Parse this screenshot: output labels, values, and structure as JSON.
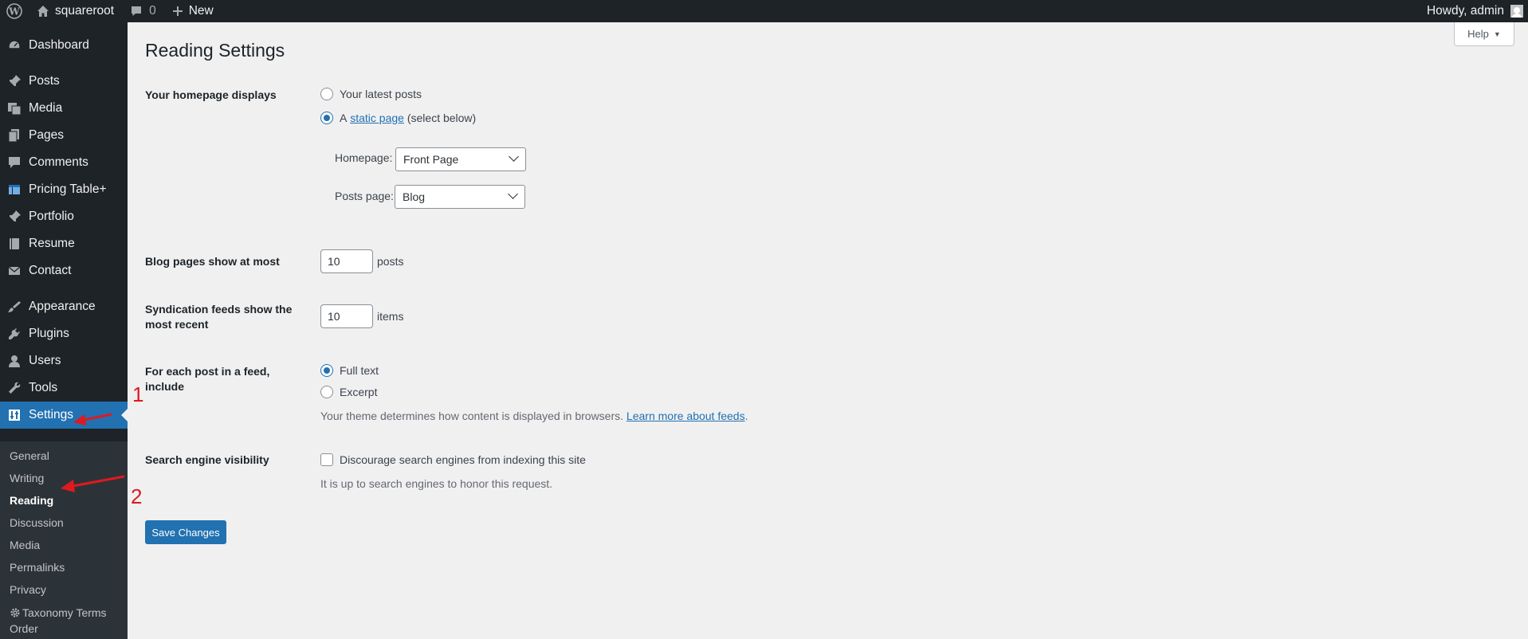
{
  "adminbar": {
    "site_name": "squareroot",
    "comments_count": "0",
    "new_label": "New",
    "greeting": "Howdy, admin"
  },
  "sidebar": {
    "items": [
      {
        "label": "Dashboard",
        "icon": "dashboard-icon"
      },
      {
        "label": "Posts",
        "icon": "pin-icon"
      },
      {
        "label": "Media",
        "icon": "media-icon"
      },
      {
        "label": "Pages",
        "icon": "pages-icon"
      },
      {
        "label": "Comments",
        "icon": "comment-icon"
      },
      {
        "label": "Pricing Table+",
        "icon": "table-icon"
      },
      {
        "label": "Portfolio",
        "icon": "pin-icon"
      },
      {
        "label": "Resume",
        "icon": "book-icon"
      },
      {
        "label": "Contact",
        "icon": "mail-icon"
      },
      {
        "label": "Appearance",
        "icon": "brush-icon"
      },
      {
        "label": "Plugins",
        "icon": "plug-icon"
      },
      {
        "label": "Users",
        "icon": "user-icon"
      },
      {
        "label": "Tools",
        "icon": "wrench-icon"
      },
      {
        "label": "Settings",
        "icon": "settings-icon"
      }
    ],
    "submenu": [
      {
        "label": "General"
      },
      {
        "label": "Writing"
      },
      {
        "label": "Reading"
      },
      {
        "label": "Discussion"
      },
      {
        "label": "Media"
      },
      {
        "label": "Permalinks"
      },
      {
        "label": "Privacy"
      },
      {
        "label": "Taxonomy Terms",
        "label2": "Order"
      }
    ]
  },
  "annotations": {
    "step1": "1",
    "step2": "2",
    "arrow_color": "#e0191f"
  },
  "main": {
    "help_label": "Help",
    "title": "Reading Settings",
    "homepage_displays": {
      "label": "Your homepage displays",
      "option_latest": "Your latest posts",
      "option_static_prefix": "A",
      "option_static_link": "static page",
      "option_static_suffix": "(select below)",
      "homepage_label": "Homepage:",
      "homepage_value": "Front Page",
      "posts_page_label": "Posts page:",
      "posts_page_value": "Blog",
      "selected": "static"
    },
    "blog_pages": {
      "label": "Blog pages show at most",
      "value": "10",
      "unit": "posts"
    },
    "syndication": {
      "label_line1": "Syndication feeds show the",
      "label_line2": "most recent",
      "value": "10",
      "unit": "items"
    },
    "feed_include": {
      "label": "For each post in a feed, include",
      "option_full": "Full text",
      "option_excerpt": "Excerpt",
      "selected": "full",
      "desc_prefix": "Your theme determines how content is displayed in browsers.",
      "desc_link": "Learn more about feeds",
      "desc_suffix": "."
    },
    "search_visibility": {
      "label": "Search engine visibility",
      "checkbox_label": "Discourage search engines from indexing this site",
      "checked": false,
      "desc": "It is up to search engines to honor this request."
    },
    "save_label": "Save Changes"
  },
  "colors": {
    "accent": "#2271b1",
    "admin_bg": "#1d2327",
    "submenu_bg": "#2c3338",
    "page_bg": "#f0f0f1"
  }
}
